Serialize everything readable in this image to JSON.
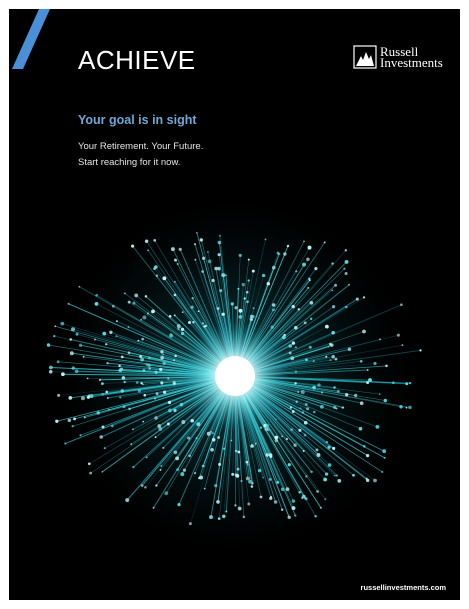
{
  "headline": "ACHIEVE",
  "logo": {
    "line1": "Russell",
    "line2": "Investments",
    "icon": "russell-chart-icon"
  },
  "subhead": "Your goal is in sight",
  "body": {
    "line1": "Your Retirement. Your Future.",
    "line2": "Start reaching for it now."
  },
  "url": "russellinvestments.com",
  "colors": {
    "background": "#000000",
    "accent_blue": "#4a90d9",
    "subhead_blue": "#6fa8d8",
    "burst_cyan": "#3ad6e0"
  },
  "image": "fiber-optic-light-burst"
}
